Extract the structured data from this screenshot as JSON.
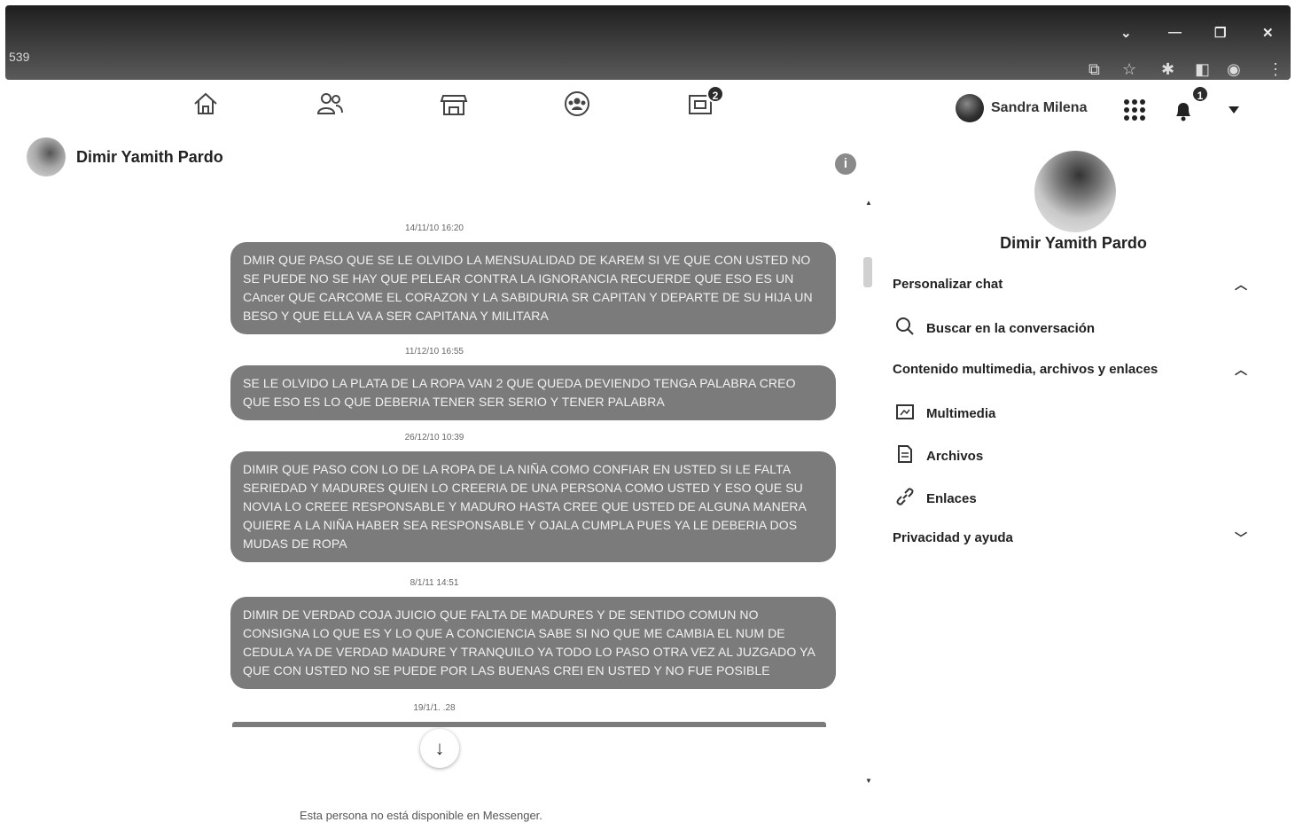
{
  "browser": {
    "tab_fragment": "539"
  },
  "nav": {
    "tabs": [
      {
        "icon": "home-icon"
      },
      {
        "icon": "friends-icon"
      },
      {
        "icon": "marketplace-icon"
      },
      {
        "icon": "groups-icon"
      },
      {
        "icon": "gaming-icon",
        "badge": "2"
      }
    ],
    "user_name": "Sandra Milena",
    "notifications_badge": "1"
  },
  "conversation": {
    "contact_name": "Dimir Yamith Pardo",
    "messages": [
      {
        "timestamp": "14/11/10 16:20",
        "text": "DMIR QUE PASO QUE SE LE OLVIDO LA MENSUALIDAD DE KAREM SI VE QUE CON USTED NO SE PUEDE NO SE HAY QUE PELEAR CONTRA LA IGNORANCIA RECUERDE QUE ESO ES UN CAncer QUE CARCOME EL CORAZON Y LA SABIDURIA SR CAPITAN Y DEPARTE DE SU HIJA UN BESO Y QUE ELLA VA A SER CAPITANA Y MILITARA"
      },
      {
        "timestamp": "11/12/10 16:55",
        "text": "SE LE OLVIDO LA PLATA DE LA ROPA VAN 2 QUE QUEDA DEVIENDO TENGA PALABRA CREO QUE ESO ES LO QUE DEBERIA TENER SER SERIO Y TENER PALABRA"
      },
      {
        "timestamp": "26/12/10 10:39",
        "text": "DIMIR QUE PASO CON LO DE LA ROPA DE LA NIÑA COMO CONFIAR EN USTED SI LE FALTA SERIEDAD Y MADURES QUIEN LO CREERIA DE UNA PERSONA COMO USTED Y ESO QUE SU NOVIA LO CREEE RESPONSABLE Y MADURO HASTA CREE QUE USTED DE ALGUNA MANERA QUIERE A LA NIÑA HABER SEA RESPONSABLE Y OJALA CUMPLA PUES YA LE DEBERIA DOS MUDAS DE ROPA"
      },
      {
        "timestamp": "8/1/11 14:51",
        "text": "DIMIR DE VERDAD COJA JUICIO QUE FALTA DE MADURES Y DE SENTIDO COMUN NO CONSIGNA LO QUE ES Y LO QUE A CONCIENCIA SABE SI NO QUE ME CAMBIA EL NUM DE CEDULA YA DE VERDAD MADURE Y TRANQUILO YA TODO LO PASO OTRA VEZ AL JUZGADO YA QUE CON USTED NO SE PUEDE POR LAS BUENAS CREI EN USTED Y NO FUE POSIBLE"
      }
    ],
    "partial_timestamp": "19/1/1.  .28",
    "unavailable_text": "Esta persona no está disponible en Messenger."
  },
  "side_panel": {
    "contact_name": "Dimir Yamith Pardo",
    "customize_chat": "Personalizar chat",
    "search_conversation": "Buscar en la conversación",
    "media_section": "Contenido multimedia, archivos y enlaces",
    "media": "Multimedia",
    "files": "Archivos",
    "links": "Enlaces",
    "privacy_help": "Privacidad y ayuda"
  }
}
